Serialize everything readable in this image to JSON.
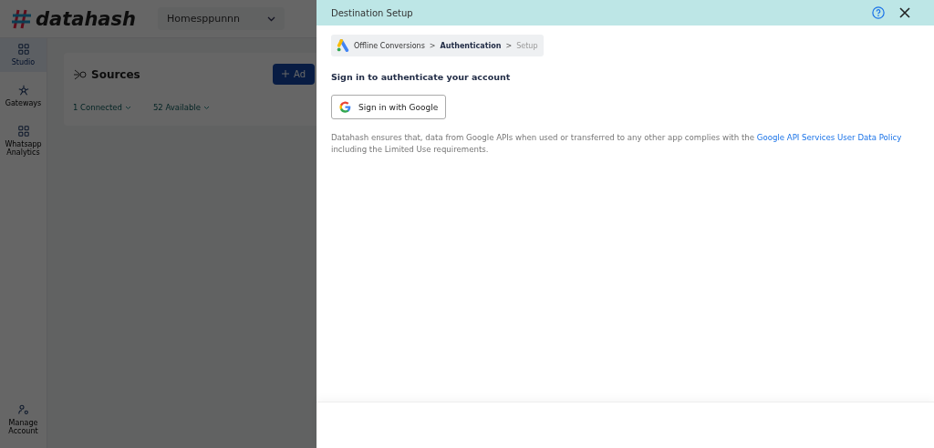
{
  "app": {
    "logo": "datahash",
    "workspace": "Homesppunnn"
  },
  "sidebar": {
    "items": [
      {
        "label": "Studio",
        "kind": "grid",
        "selected": true
      },
      {
        "label": "Gateways",
        "kind": "hub",
        "selected": false
      },
      {
        "label": "Whatsapp Analytics",
        "kind": "grid",
        "selected": false
      }
    ],
    "footer_item": {
      "label": "Manage Account"
    }
  },
  "sources_card": {
    "title": "Sources",
    "add_button": "Ad",
    "filters": [
      "1 Connected",
      "52 Available"
    ]
  },
  "panel": {
    "title": "Destination Setup",
    "breadcrumb_separators": [
      ">",
      ">"
    ],
    "breadcrumb": [
      {
        "label": "Offline Conversions",
        "kind": "link"
      },
      {
        "label": "Authentication",
        "kind": "current"
      },
      {
        "label": "Setup",
        "kind": "pending"
      }
    ],
    "heading": "Sign in to authenticate your account",
    "google_button": "Sign in with Google",
    "notice": {
      "text": "Datahash ensures that, data from Google APIs when used or transferred to any other app complies with the ",
      "link": "Google API Services User Data Policy",
      "after": " including the Limited Use requirements."
    }
  }
}
